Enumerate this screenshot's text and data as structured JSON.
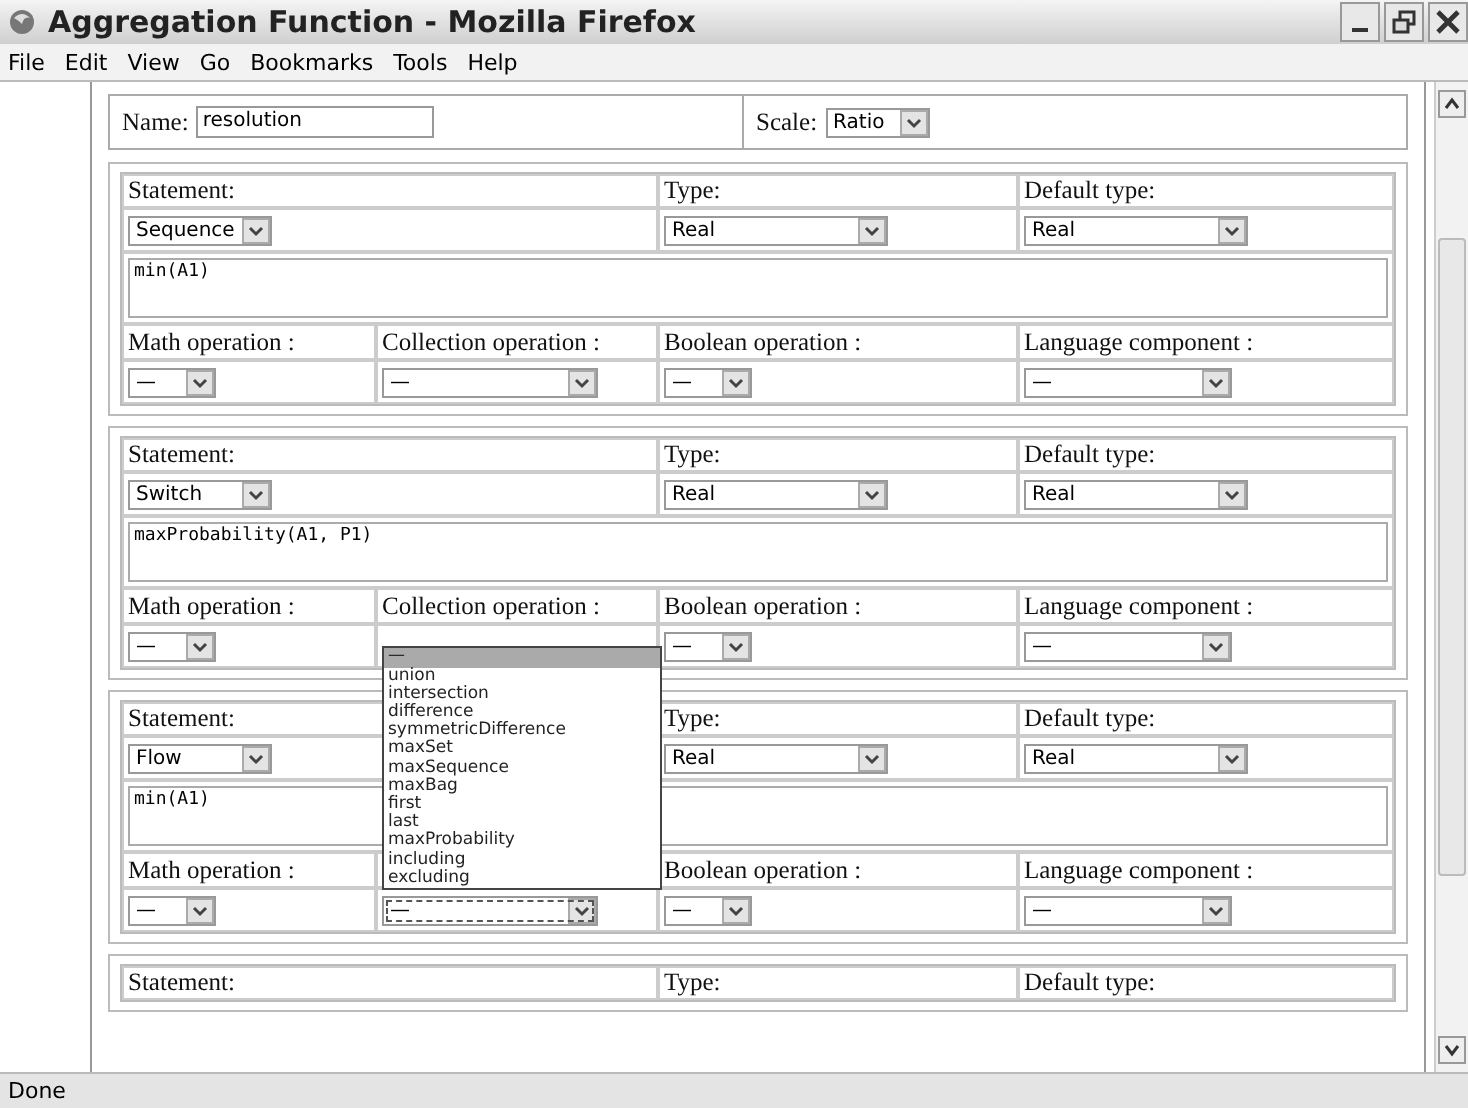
{
  "window": {
    "title": "Aggregation Function - Mozilla Firefox"
  },
  "menu": [
    "File",
    "Edit",
    "View",
    "Go",
    "Bookmarks",
    "Tools",
    "Help"
  ],
  "name_field": {
    "label": "Name:",
    "value": "resolution"
  },
  "scale": {
    "label": "Scale:",
    "value": "Ratio"
  },
  "blocks": [
    {
      "statement_label": "Statement:",
      "statement": "Sequence",
      "type_label": "Type:",
      "type": "Real",
      "default_type_label": "Default type:",
      "default_type": "Real",
      "expression": "min(A1)",
      "operations": [
        {
          "label": "Math operation :",
          "value": "—"
        },
        {
          "label": "Collection operation :",
          "value": "—"
        },
        {
          "label": "Boolean operation :",
          "value": "—"
        },
        {
          "label": "Language component :",
          "value": "—"
        }
      ]
    },
    {
      "statement_label": "Statement:",
      "statement": "Switch",
      "type_label": "Type:",
      "type": "Real",
      "default_type_label": "Default type:",
      "default_type": "Real",
      "expression": "maxProbability(A1, P1)",
      "operations": [
        {
          "label": "Math operation :",
          "value": "—"
        },
        {
          "label": "Collection operation :"
        },
        {
          "label": "Boolean operation :",
          "value": "—"
        },
        {
          "label": "Language component :",
          "value": "—"
        }
      ]
    },
    {
      "statement_label": "Statement:",
      "statement": "Flow",
      "type_label": "Type:",
      "type": "Real",
      "default_type_label": "Default type:",
      "default_type": "Real",
      "expression": "min(A1)",
      "operations": [
        {
          "label": "Math operation :",
          "value": "—"
        },
        {
          "value": "—",
          "focused": true,
          "open": true
        },
        {
          "label": "Boolean operation :",
          "value": "—"
        },
        {
          "label": "Language component :",
          "value": "—"
        }
      ]
    },
    {
      "statement_label": "Statement:",
      "type_label": "Type:",
      "default_type_label": "Default type:"
    }
  ],
  "dropdown": {
    "items": [
      {
        "label": "—",
        "selected": true
      },
      {
        "label": "union",
        "selected": false
      },
      {
        "label": "intersection",
        "selected": false
      },
      {
        "label": "difference",
        "selected": false
      },
      {
        "label": "symmetricDifference",
        "selected": false
      },
      {
        "label": "maxSet",
        "selected": false
      },
      {
        "label": "maxSequence",
        "selected": false
      },
      {
        "label": "maxBag",
        "selected": false
      },
      {
        "label": "first",
        "selected": false
      },
      {
        "label": "last",
        "selected": false
      },
      {
        "label": "maxProbability",
        "selected": false
      },
      {
        "label": "including",
        "selected": false
      },
      {
        "label": "excluding",
        "selected": false
      }
    ]
  },
  "status_bar": "Done"
}
